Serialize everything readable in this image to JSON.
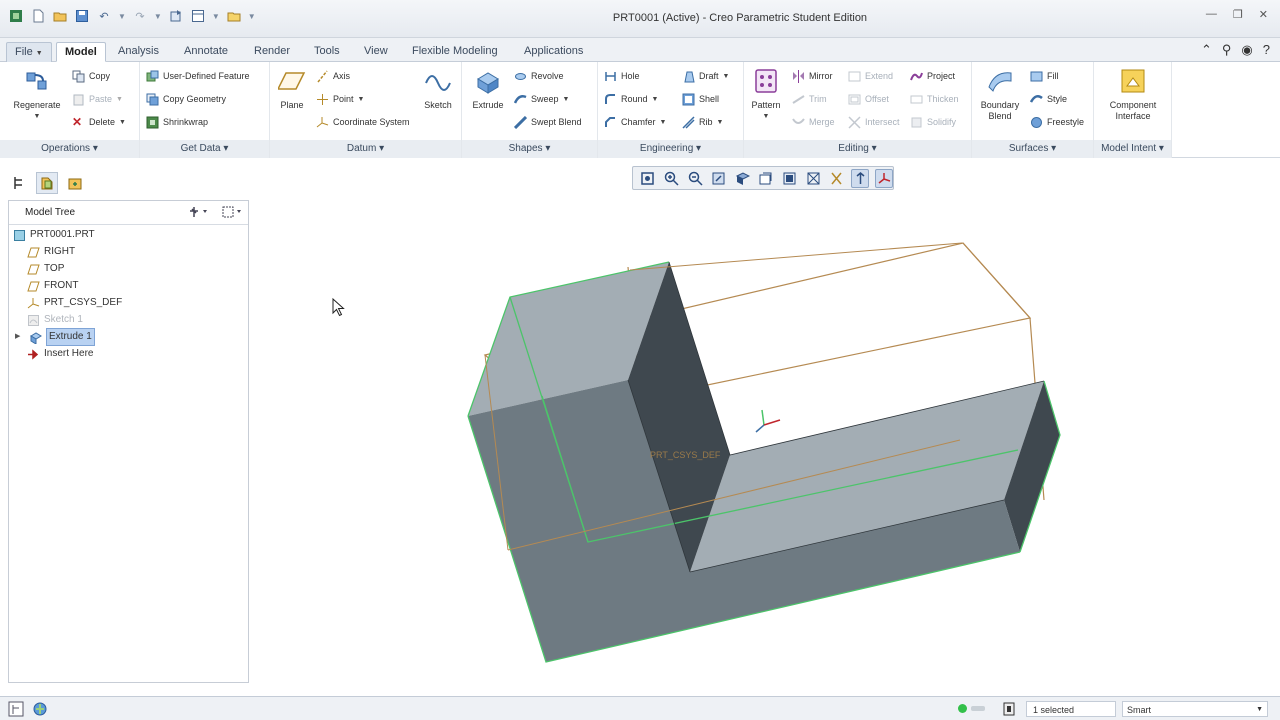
{
  "window": {
    "title": "PRT0001 (Active) - Creo Parametric Student Edition"
  },
  "ribbon_tabs": [
    "File",
    "Model",
    "Analysis",
    "Annotate",
    "Render",
    "Tools",
    "View",
    "Flexible Modeling",
    "Applications"
  ],
  "active_tab": "Model",
  "ribbon": {
    "operations": {
      "label": "Operations",
      "regenerate": "Regenerate",
      "copy": "Copy",
      "paste": "Paste",
      "delete": "Delete"
    },
    "get_data": {
      "label": "Get Data",
      "user_defined_feature": "User-Defined Feature",
      "copy_geometry": "Copy Geometry",
      "shrinkwrap": "Shrinkwrap"
    },
    "datum": {
      "label": "Datum",
      "plane": "Plane",
      "axis": "Axis",
      "point": "Point",
      "coordinate_system": "Coordinate System",
      "sketch": "Sketch"
    },
    "shapes": {
      "label": "Shapes",
      "extrude": "Extrude",
      "revolve": "Revolve",
      "sweep": "Sweep",
      "swept_blend": "Swept Blend"
    },
    "engineering": {
      "label": "Engineering",
      "hole": "Hole",
      "round": "Round",
      "chamfer": "Chamfer",
      "draft": "Draft",
      "shell": "Shell",
      "rib": "Rib"
    },
    "editing": {
      "label": "Editing",
      "pattern": "Pattern",
      "mirror": "Mirror",
      "trim": "Trim",
      "merge": "Merge",
      "extend": "Extend",
      "offset": "Offset",
      "intersect": "Intersect",
      "project": "Project",
      "thicken": "Thicken",
      "solidify": "Solidify"
    },
    "surfaces": {
      "label": "Surfaces",
      "boundary_blend": "Boundary Blend",
      "fill": "Fill",
      "style": "Style",
      "freestyle": "Freestyle"
    },
    "model_intent": {
      "label": "Model Intent",
      "component_interface": "Component Interface"
    }
  },
  "model_tree": {
    "title": "Model Tree",
    "items": [
      {
        "label": "PRT0001.PRT",
        "icon": "part-icon"
      },
      {
        "label": "RIGHT",
        "icon": "datum-plane-icon"
      },
      {
        "label": "TOP",
        "icon": "datum-plane-icon"
      },
      {
        "label": "FRONT",
        "icon": "datum-plane-icon"
      },
      {
        "label": "PRT_CSYS_DEF",
        "icon": "csys-icon"
      },
      {
        "label": "Sketch 1",
        "icon": "sketch-icon"
      },
      {
        "label": "Extrude 1",
        "icon": "extrude-icon"
      },
      {
        "label": "Insert Here",
        "icon": "insert-arrow-icon"
      }
    ]
  },
  "canvas": {
    "csys_label": "PRT_CSYS_DEF",
    "part_color": "#6e7a82",
    "top_face_color": "#a3adb4",
    "dark_face_color": "#3f484f",
    "edge_highlight_color": "#4cc46a",
    "datum_color": "#b58a52"
  },
  "status": {
    "selected": "1 selected",
    "filter": "Smart"
  }
}
